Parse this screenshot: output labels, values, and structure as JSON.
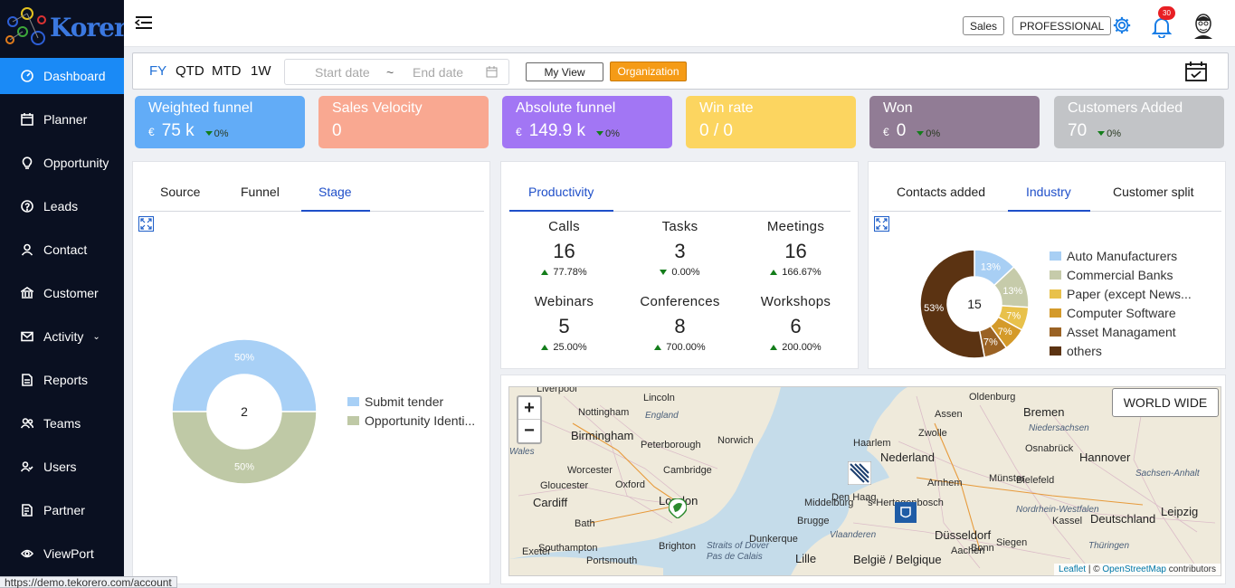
{
  "app": {
    "logo_text": "Korero",
    "status_url": "https://demo.tekorero.com/account"
  },
  "sidebar": {
    "items": [
      {
        "label": "Dashboard",
        "icon": "dashboard-icon"
      },
      {
        "label": "Planner",
        "icon": "calendar-icon"
      },
      {
        "label": "Opportunity",
        "icon": "bulb-icon"
      },
      {
        "label": "Leads",
        "icon": "question-icon"
      },
      {
        "label": "Contact",
        "icon": "user-icon"
      },
      {
        "label": "Customer",
        "icon": "bank-icon"
      },
      {
        "label": "Activity",
        "icon": "mail-icon"
      },
      {
        "label": "Reports",
        "icon": "file-icon"
      },
      {
        "label": "Teams",
        "icon": "team-icon"
      },
      {
        "label": "Users",
        "icon": "users-icon"
      },
      {
        "label": "Partner",
        "icon": "partner-icon"
      },
      {
        "label": "ViewPort",
        "icon": "eye-icon"
      }
    ]
  },
  "topbar": {
    "sales_label": "Sales",
    "plan_label": "PROFESSIONAL",
    "notification_count": "30"
  },
  "filters": {
    "periods": [
      "FY",
      "QTD",
      "MTD",
      "1W"
    ],
    "start_placeholder": "Start date",
    "end_placeholder": "End date",
    "separator": "~",
    "my_view": "My View",
    "organization": "Organization"
  },
  "kpis": [
    {
      "title": "Weighted funnel",
      "currency": "€",
      "value": "75 k",
      "change": "0%",
      "color": "#62acf7"
    },
    {
      "title": "Sales Velocity",
      "currency": "",
      "value": "0",
      "change": "",
      "color": "#f9a891"
    },
    {
      "title": "Absolute funnel",
      "currency": "€",
      "value": "149.9 k",
      "change": "0%",
      "color": "#a276f4"
    },
    {
      "title": "Win rate",
      "currency": "",
      "value": "0 / 0",
      "change": "",
      "color": "#fcd560"
    },
    {
      "title": "Won",
      "currency": "€",
      "value": "0",
      "change": "0%",
      "color": "#917c95"
    },
    {
      "title": "Customers Added",
      "currency": "",
      "value": "70",
      "change": "0%",
      "color": "#c2c4c7"
    }
  ],
  "funnel_panel": {
    "tabs": [
      "Source",
      "Funnel",
      "Stage"
    ],
    "active_tab": "Stage",
    "center": "2",
    "slices": [
      {
        "label": "Submit tender",
        "pct": "50%",
        "color": "#a8d0f6"
      },
      {
        "label": "Opportunity Identi...",
        "pct": "50%",
        "color": "#bfc9a6"
      }
    ]
  },
  "productivity": {
    "tab": "Productivity",
    "items": [
      {
        "label": "Calls",
        "value": "16",
        "change": "77.78%",
        "dir": "up"
      },
      {
        "label": "Tasks",
        "value": "3",
        "change": "0.00%",
        "dir": "down"
      },
      {
        "label": "Meetings",
        "value": "16",
        "change": "166.67%",
        "dir": "up"
      },
      {
        "label": "Webinars",
        "value": "5",
        "change": "25.00%",
        "dir": "up"
      },
      {
        "label": "Conferences",
        "value": "8",
        "change": "700.00%",
        "dir": "up"
      },
      {
        "label": "Workshops",
        "value": "6",
        "change": "200.00%",
        "dir": "up"
      }
    ]
  },
  "industry_panel": {
    "tabs": [
      "Contacts added",
      "Industry",
      "Customer split"
    ],
    "active_tab": "Industry",
    "center": "15",
    "slices": [
      {
        "label": "Auto Manufacturers",
        "pct": "13%",
        "value": 13,
        "color": "#a8cff4"
      },
      {
        "label": "Commercial Banks",
        "pct": "13%",
        "value": 13,
        "color": "#c6cbaa"
      },
      {
        "label": "Paper (except News...",
        "pct": "7%",
        "value": 7,
        "color": "#e8c14b"
      },
      {
        "label": "Computer Software",
        "pct": "7%",
        "value": 7,
        "color": "#d49a2a"
      },
      {
        "label": "Asset Managament",
        "pct": "7%",
        "value": 7,
        "color": "#9a6224"
      },
      {
        "label": "others",
        "pct": "53%",
        "value": 53,
        "color": "#5b3312"
      }
    ]
  },
  "map": {
    "world_wide": "WORLD WIDE",
    "zoom_in": "+",
    "zoom_out": "−",
    "attribution_leaflet": "Leaflet",
    "attribution_sep": "| ©",
    "attribution_osm": "OpenStreetMap",
    "attribution_tail": "contributors",
    "labels": [
      "Liverpool",
      "Lincoln",
      "Nottingham",
      "England",
      "Birmingham",
      "Peterborough",
      "Norwich",
      "Wales",
      "Worcester",
      "Cambridge",
      "Gloucester",
      "Oxford",
      "Cardiff",
      "London",
      "Bath",
      "Southampton",
      "Brighton",
      "Portsmouth",
      "Exeter",
      "Dunkerque",
      "Lille",
      "Brugge",
      "Middelburg",
      "Haarlem",
      "Nederland",
      "Zwolle",
      "Arnhem",
      "Oldenburg",
      "Bremen",
      "Niedersachsen",
      "Osnabrück",
      "Hannover",
      "Münster",
      "Bielefeld",
      "Nordrhein-Westfalen",
      "Kassel",
      "Deutschland",
      "Düsseldorf",
      "Bonn",
      "Aachen",
      "Siegen",
      "Leipzig",
      "Thüringen",
      "Vlaanderen",
      "België / Belgique",
      "Assen",
      "Sachsen-Anhalt",
      "Straits of Dover",
      "Pas de Calais",
      "'s-Hertogenbosch",
      "Den Haag"
    ]
  }
}
